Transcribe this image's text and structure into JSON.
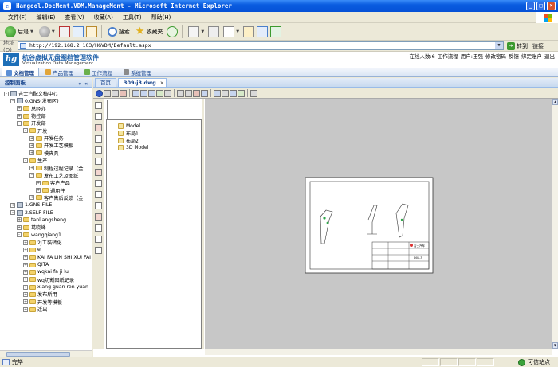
{
  "window": {
    "title": "Hangool.DocMent.VDM.ManageMent - Microsoft Internet Explorer",
    "controls": [
      "_",
      "□",
      "×"
    ]
  },
  "menu": [
    "文件(F)",
    "编辑(E)",
    "查看(V)",
    "收藏(A)",
    "工具(T)",
    "帮助(H)"
  ],
  "toolbar": {
    "back": "后退",
    "search": "搜索",
    "favorites": "收藏夹"
  },
  "address": {
    "label": "地址(D)",
    "url": "http://192.168.2.103/HGVDM/Default.aspx",
    "go": "转到",
    "links": "链接"
  },
  "app": {
    "logo_mark": "hg",
    "logo_cn": "杭谷虚拟无盘图档管理软件",
    "logo_en": "Virtualization Data Management",
    "user_links": [
      "在线人数:6",
      "工作流程",
      "用户:王强",
      "修改密码",
      "反馈",
      "绑定账户",
      "退出"
    ]
  },
  "modules": [
    {
      "label": "文档管理",
      "active": true
    },
    {
      "label": "产品管理",
      "active": false
    },
    {
      "label": "工作流程",
      "active": false
    },
    {
      "label": "系统管理",
      "active": false
    }
  ],
  "left_panel": {
    "title": "控制面板",
    "collapse": "« «"
  },
  "tree": [
    {
      "label": "吉士汽配文档中心",
      "level": 0,
      "exp": "-",
      "kind": "drive"
    },
    {
      "label": "0.GNS(发布区)",
      "level": 1,
      "exp": "-",
      "kind": "drive"
    },
    {
      "label": "总经办",
      "level": 2,
      "exp": "+",
      "kind": "folder"
    },
    {
      "label": "物控部",
      "level": 2,
      "exp": "+",
      "kind": "folder"
    },
    {
      "label": "开发部",
      "level": 2,
      "exp": "-",
      "kind": "folder"
    },
    {
      "label": "开发",
      "level": 3,
      "exp": "-",
      "kind": "folder"
    },
    {
      "label": "开发任务",
      "level": 4,
      "exp": "+",
      "kind": "folder"
    },
    {
      "label": "开发工艺模板",
      "level": 4,
      "exp": "+",
      "kind": "folder"
    },
    {
      "label": "模夹具",
      "level": 4,
      "exp": "+",
      "kind": "folder"
    },
    {
      "label": "生产",
      "level": 3,
      "exp": "-",
      "kind": "folder"
    },
    {
      "label": "制程过程记录（金",
      "level": 4,
      "exp": "+",
      "kind": "folder"
    },
    {
      "label": "发布工艺及图纸",
      "level": 4,
      "exp": "-",
      "kind": "folder"
    },
    {
      "label": "客户产品",
      "level": 5,
      "exp": "+",
      "kind": "folder"
    },
    {
      "label": "通用件",
      "level": 5,
      "exp": "+",
      "kind": "folder"
    },
    {
      "label": "客户售后反馈（金",
      "level": 4,
      "exp": "+",
      "kind": "folder"
    },
    {
      "label": "1.GNS-FILE",
      "level": 1,
      "exp": "+",
      "kind": "drive"
    },
    {
      "label": "2.SELF-FILE",
      "level": 1,
      "exp": "-",
      "kind": "drive"
    },
    {
      "label": "tanliangsheng",
      "level": 2,
      "exp": "+",
      "kind": "folder"
    },
    {
      "label": "葛晓峰",
      "level": 2,
      "exp": "+",
      "kind": "folder"
    },
    {
      "label": "wangqiang1",
      "level": 2,
      "exp": "-",
      "kind": "folder"
    },
    {
      "label": "2J工装转化",
      "level": 3,
      "exp": "+",
      "kind": "folder"
    },
    {
      "label": "e",
      "level": 3,
      "exp": "+",
      "kind": "folder"
    },
    {
      "label": "KAI FA LIN SHI XUI FAI",
      "level": 3,
      "exp": "+",
      "kind": "folder"
    },
    {
      "label": "QITA",
      "level": 3,
      "exp": "+",
      "kind": "folder"
    },
    {
      "label": "wqkai fa ji lu",
      "level": 3,
      "exp": "+",
      "kind": "folder"
    },
    {
      "label": "wq切割图纸记录",
      "level": 3,
      "exp": "+",
      "kind": "folder"
    },
    {
      "label": "xiang guan ren yuan",
      "level": 3,
      "exp": "+",
      "kind": "folder"
    },
    {
      "label": "发布所用",
      "level": 3,
      "exp": "+",
      "kind": "folder"
    },
    {
      "label": "开发等模板",
      "level": 3,
      "exp": "+",
      "kind": "folder"
    },
    {
      "label": "迁出",
      "level": 3,
      "exp": "+",
      "kind": "folder"
    }
  ],
  "doc_tabs": [
    {
      "label": "首页",
      "active": false
    },
    {
      "label": "309-j3.dwg",
      "active": true
    }
  ],
  "layouts": [
    "Model",
    "布局1",
    "布局2",
    "3D Model"
  ],
  "drawing": {
    "title_block_name": "D01-3",
    "company": "吉士汽车"
  },
  "status": {
    "text": "完毕",
    "zone": "可信站点"
  },
  "colors": {
    "title_bar": "#0551d6",
    "accent": "#15428b",
    "canvas_bg": "#c7c7c7"
  }
}
